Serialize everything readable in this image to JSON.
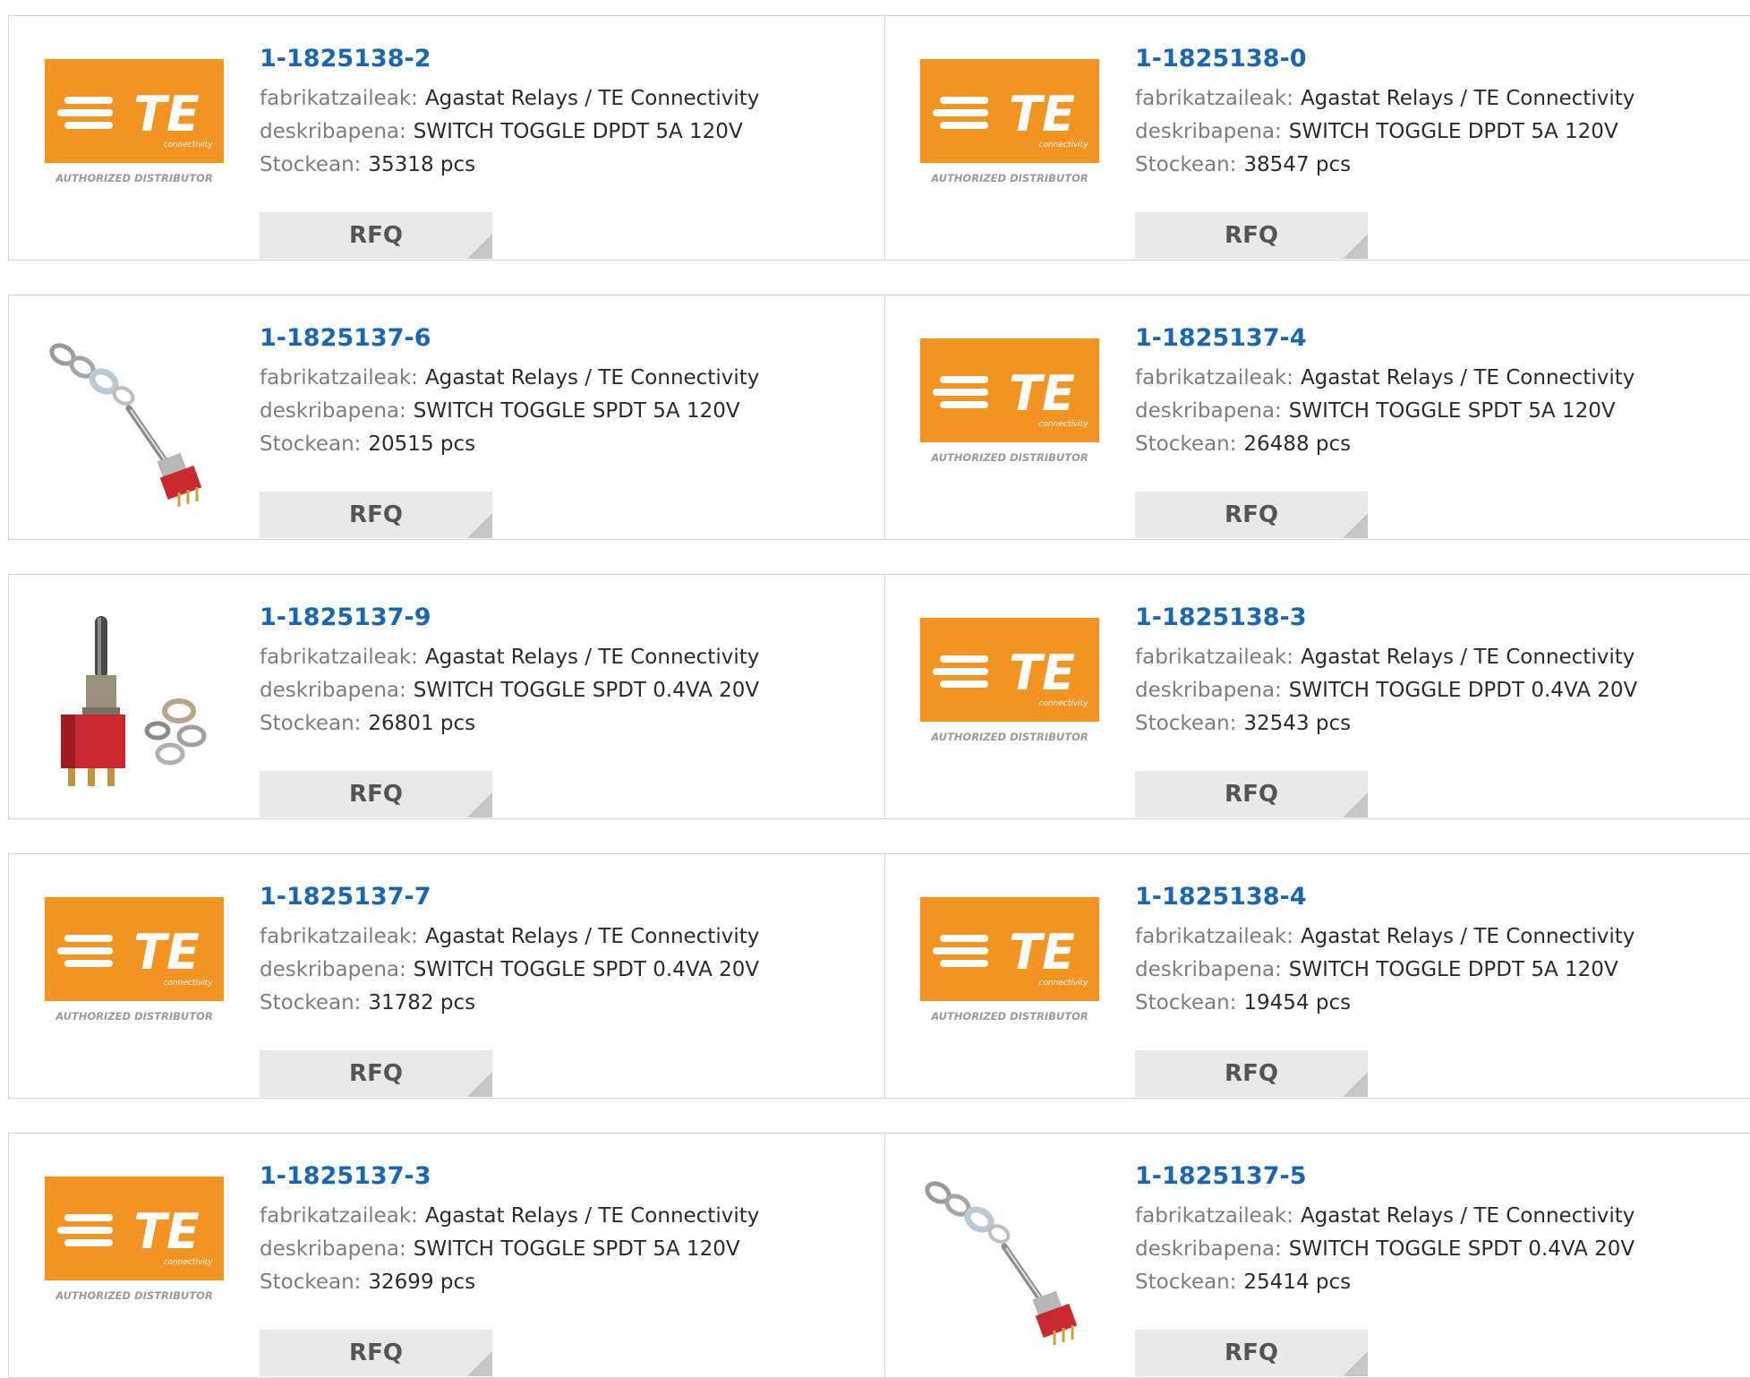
{
  "labels": {
    "manufacturer": "fabrikatzaileak:",
    "description": "deskribapena:",
    "stock": "Stockean:",
    "rfq": "RFQ",
    "logo_brand": "TE",
    "logo_sub": "connectivity",
    "logo_tag": "AUTHORIZED DISTRIBUTOR"
  },
  "colors": {
    "part_link": "#1a67b1",
    "te_orange": "#f39322",
    "label_gray": "#7d7d7d"
  },
  "products": [
    {
      "part": "1-1825138-2",
      "manufacturer": "Agastat Relays / TE Connectivity",
      "description": "SWITCH TOGGLE DPDT 5A 120V",
      "stock": "35318 pcs",
      "image": "te-logo"
    },
    {
      "part": "1-1825138-0",
      "manufacturer": "Agastat Relays / TE Connectivity",
      "description": "SWITCH TOGGLE DPDT 5A 120V",
      "stock": "38547 pcs",
      "image": "te-logo"
    },
    {
      "part": "1-1825137-6",
      "manufacturer": "Agastat Relays / TE Connectivity",
      "description": "SWITCH TOGGLE SPDT 5A 120V",
      "stock": "20515 pcs",
      "image": "toggle-exploded"
    },
    {
      "part": "1-1825137-4",
      "manufacturer": "Agastat Relays / TE Connectivity",
      "description": "SWITCH TOGGLE SPDT 5A 120V",
      "stock": "26488 pcs",
      "image": "te-logo"
    },
    {
      "part": "1-1825137-9",
      "manufacturer": "Agastat Relays / TE Connectivity",
      "description": "SWITCH TOGGLE SPDT 0.4VA 20V",
      "stock": "26801 pcs",
      "image": "toggle-upright"
    },
    {
      "part": "1-1825138-3",
      "manufacturer": "Agastat Relays / TE Connectivity",
      "description": "SWITCH TOGGLE DPDT 0.4VA 20V",
      "stock": "32543 pcs",
      "image": "te-logo"
    },
    {
      "part": "1-1825137-7",
      "manufacturer": "Agastat Relays / TE Connectivity",
      "description": "SWITCH TOGGLE SPDT 0.4VA 20V",
      "stock": "31782 pcs",
      "image": "te-logo"
    },
    {
      "part": "1-1825138-4",
      "manufacturer": "Agastat Relays / TE Connectivity",
      "description": "SWITCH TOGGLE DPDT 5A 120V",
      "stock": "19454 pcs",
      "image": "te-logo"
    },
    {
      "part": "1-1825137-3",
      "manufacturer": "Agastat Relays / TE Connectivity",
      "description": "SWITCH TOGGLE SPDT 5A 120V",
      "stock": "32699 pcs",
      "image": "te-logo"
    },
    {
      "part": "1-1825137-5",
      "manufacturer": "Agastat Relays / TE Connectivity",
      "description": "SWITCH TOGGLE SPDT 0.4VA 20V",
      "stock": "25414 pcs",
      "image": "toggle-exploded"
    }
  ]
}
